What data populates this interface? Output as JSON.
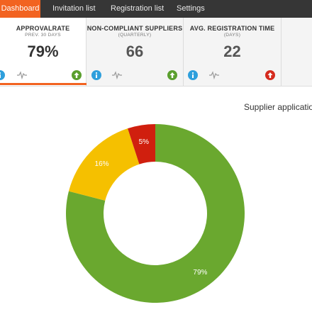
{
  "nav": {
    "tabs": [
      {
        "label": "Dashboard",
        "active": true
      },
      {
        "label": "Invitation list",
        "active": false
      },
      {
        "label": "Registration list",
        "active": false
      },
      {
        "label": "Settings",
        "active": false
      }
    ]
  },
  "kpis": [
    {
      "title": "APPROVALRATE",
      "subtitle": "PREV. 30 DAYS",
      "value": "79%",
      "trend": "up",
      "trend_color": "#5a9f2e"
    },
    {
      "title": "NON-COMPLIANT SUPPLIERS",
      "subtitle": "(QUARTERLY)",
      "value": "66",
      "trend": "up",
      "trend_color": "#5a9f2e"
    },
    {
      "title": "AVG. REGISTRATION TIME",
      "subtitle": "(DAYS)",
      "value": "22",
      "trend": "up",
      "trend_color": "#d52b1e"
    }
  ],
  "colors": {
    "accent": "#f26321",
    "info": "#2e9fdc",
    "green": "#6aa82f",
    "yellow": "#f5c000",
    "red": "#d01f0e"
  },
  "chart_data": {
    "type": "pie",
    "title": "Supplier applicatio",
    "categories": [
      "",
      "",
      ""
    ],
    "values": [
      79,
      16,
      5
    ],
    "labels": [
      "79%",
      "16%",
      "5%"
    ],
    "colors": [
      "#6aa82f",
      "#f5c000",
      "#d01f0e"
    ],
    "donut": true
  }
}
